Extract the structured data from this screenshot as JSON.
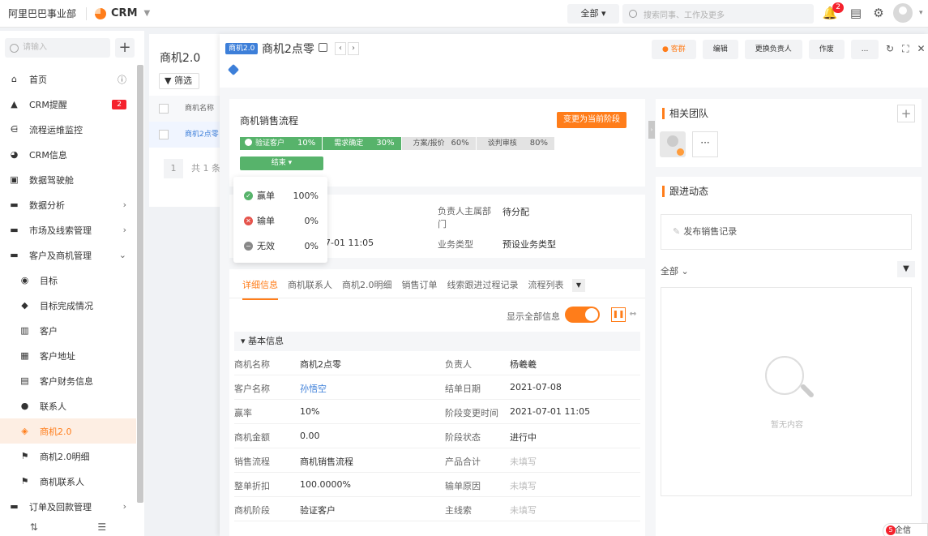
{
  "topbar": {
    "org": "阿里巴巴事业部",
    "app": "CRM",
    "scope": "全部",
    "search_placeholder": "搜索同事、工作及更多",
    "notify_count": "2"
  },
  "sidebar": {
    "search_placeholder": "请输入",
    "items": [
      {
        "label": "首页",
        "icon": "home-icon"
      },
      {
        "label": "CRM提醒",
        "icon": "bell-icon",
        "badge": "2"
      },
      {
        "label": "流程运维监控",
        "icon": "flow-icon"
      },
      {
        "label": "CRM信息",
        "icon": "pie-icon"
      },
      {
        "label": "数据驾驶舱",
        "icon": "dashboard-icon"
      },
      {
        "label": "数据分析",
        "icon": "folder-icon"
      },
      {
        "label": "市场及线索管理",
        "icon": "folder-icon"
      },
      {
        "label": "客户及商机管理",
        "icon": "folder-icon"
      },
      {
        "label": "目标",
        "icon": "target-icon"
      },
      {
        "label": "目标完成情况",
        "icon": "shield-check-icon"
      },
      {
        "label": "客户",
        "icon": "building-icon"
      },
      {
        "label": "客户地址",
        "icon": "address-icon"
      },
      {
        "label": "客户财务信息",
        "icon": "finance-icon"
      },
      {
        "label": "联系人",
        "icon": "person-icon"
      },
      {
        "label": "商机2.0",
        "icon": "opportunity-icon"
      },
      {
        "label": "商机2.0明细",
        "icon": "flag-icon"
      },
      {
        "label": "商机联系人",
        "icon": "flag-icon"
      },
      {
        "label": "订单及回款管理",
        "icon": "folder-icon"
      }
    ]
  },
  "list": {
    "title": "商机2.0",
    "filter": "筛选",
    "col": "商机名称",
    "row": "商机2点零",
    "page": "1",
    "total": "共 1 条"
  },
  "detail": {
    "tag": "商机2.0",
    "title": "商机2点零",
    "buttons": {
      "group": "客群",
      "edit": "编辑",
      "owner": "更换负责人",
      "void": "作废",
      "more": "..."
    },
    "stage_card": {
      "title": "商机销售流程",
      "change_btn": "变更为当前阶段",
      "stages": [
        {
          "name": "验证客户",
          "pct": "10%"
        },
        {
          "name": "需求确定",
          "pct": "30%"
        },
        {
          "name": "方案/报价",
          "pct": "60%"
        },
        {
          "name": "谈判审核",
          "pct": "80%"
        }
      ],
      "end": "结束",
      "outcomes": [
        {
          "name": "赢单",
          "pct": "100%"
        },
        {
          "name": "输单",
          "pct": "0%"
        },
        {
          "name": "无效",
          "pct": "0%"
        }
      ]
    },
    "info": {
      "dept_label": "负责人主属部门",
      "dept_value": "待分配",
      "time_value": "7-01 11:05",
      "biz_label": "业务类型",
      "biz_value": "预设业务类型"
    },
    "tabs": [
      "详细信息",
      "商机联系人",
      "商机2.0明细",
      "销售订单",
      "线索跟进过程记录",
      "流程列表"
    ],
    "show_all": "显示全部信息",
    "section": "基本信息",
    "fields": [
      [
        "商机名称",
        "商机2点零",
        "负责人",
        "杨羲羲"
      ],
      [
        "客户名称",
        "孙悟空",
        "结单日期",
        "2021-07-08"
      ],
      [
        "赢率",
        "10%",
        "阶段变更时间",
        "2021-07-01 11:05"
      ],
      [
        "商机金额",
        "0.00",
        "阶段状态",
        "进行中"
      ],
      [
        "销售流程",
        "商机销售流程",
        "产品合计",
        "未填写"
      ],
      [
        "整单折扣",
        "100.0000%",
        "输单原因",
        "未填写"
      ],
      [
        "商机阶段",
        "验证客户",
        "主线索",
        "未填写"
      ]
    ],
    "team_title": "相关团队",
    "feed_title": "跟进动态",
    "post_label": "发布销售记录",
    "feed_filter": "全部",
    "empty_text": "暂无内容",
    "qixin": "企信",
    "qixin_count": "5"
  },
  "colors": {
    "accent": "#ff7d1a",
    "link": "#3d7fd9",
    "green": "#57b36b",
    "red": "#f5222d"
  }
}
